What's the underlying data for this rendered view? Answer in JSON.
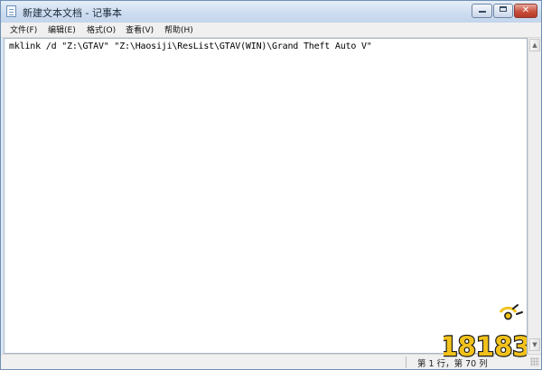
{
  "window": {
    "title": "新建文本文档 - 记事本",
    "icon": "notepad-icon",
    "controls": [
      "minimize-icon",
      "maximize-icon",
      "close-icon"
    ]
  },
  "menu": [
    {
      "label": "文件(F)"
    },
    {
      "label": "编辑(E)"
    },
    {
      "label": "格式(O)"
    },
    {
      "label": "查看(V)"
    },
    {
      "label": "帮助(H)"
    }
  ],
  "editor": {
    "text": "mklink /d \"Z:\\GTAV\" \"Z:\\Haosiji\\ResList\\GTAV(WIN)\\Grand Theft Auto V\""
  },
  "status": {
    "position": "第 1 行，第 70 列"
  },
  "watermark": {
    "text": "18183",
    "colors": {
      "main": "#f2c21b",
      "outline": "#1a1a1a"
    }
  }
}
